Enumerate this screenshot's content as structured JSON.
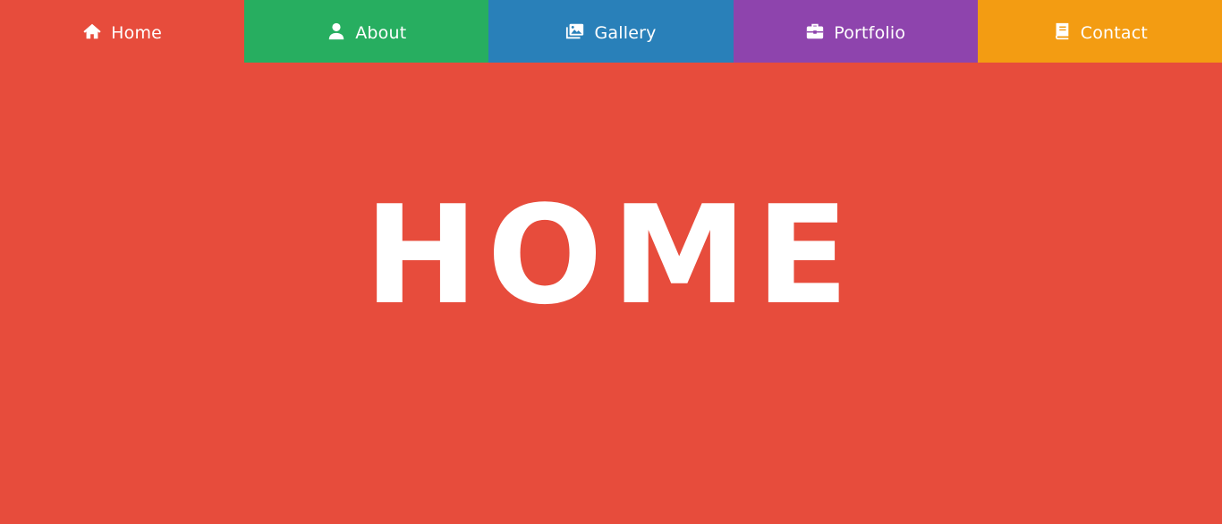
{
  "nav": {
    "tabs": [
      {
        "label": "Home",
        "icon": "home-icon",
        "color": "#e74c3c",
        "active": true
      },
      {
        "label": "About",
        "icon": "user-icon",
        "color": "#27ae60",
        "active": false
      },
      {
        "label": "Gallery",
        "icon": "images-icon",
        "color": "#2980b9",
        "active": false
      },
      {
        "label": "Portfolio",
        "icon": "briefcase-icon",
        "color": "#8e44ad",
        "active": false
      },
      {
        "label": "Contact",
        "icon": "book-icon",
        "color": "#f39c12",
        "active": false
      }
    ]
  },
  "hero": {
    "title": "HOME",
    "background": "#e74c3c",
    "text_color": "#ffffff"
  }
}
